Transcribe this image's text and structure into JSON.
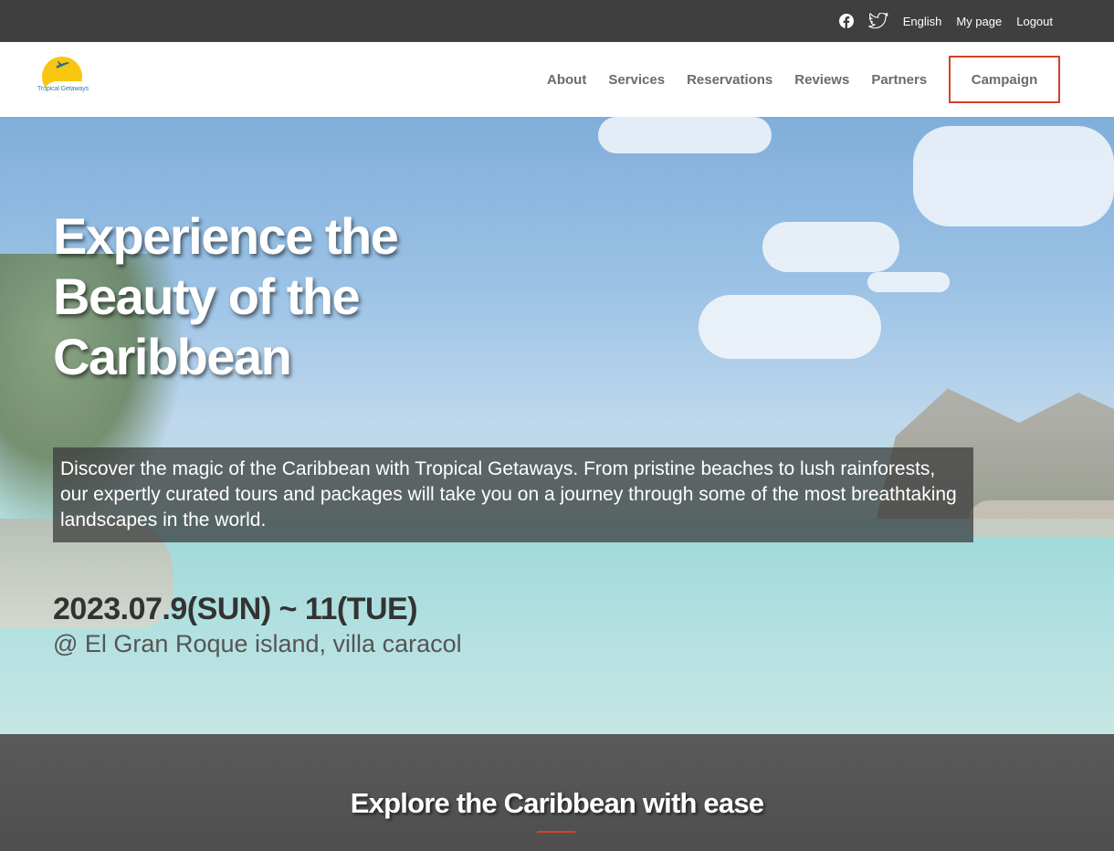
{
  "topbar": {
    "language": "English",
    "mypage": "My page",
    "logout": "Logout"
  },
  "logo": {
    "brand": "Tropical Getaways"
  },
  "nav": {
    "items": [
      {
        "label": "About"
      },
      {
        "label": "Services"
      },
      {
        "label": "Reservations"
      },
      {
        "label": "Reviews"
      },
      {
        "label": "Partners"
      }
    ],
    "campaign": "Campaign"
  },
  "hero": {
    "title": "Experience the Beauty of the Caribbean",
    "description": "Discover the magic of the Caribbean with Tropical Getaways. From pristine beaches to lush rainforests, our expertly curated tours and packages will take you on a journey through some of the most breathtaking landscapes in the world.",
    "date": "2023.07.9(SUN) ~ 11(TUE)",
    "venue": "@ El Gran Roque island, villa caracol"
  },
  "explore": {
    "heading": "Explore the Caribbean with ease"
  },
  "colors": {
    "topbar": "#3f3f3f",
    "accent": "#d6402a",
    "nav_text": "#6b6b6b",
    "logo_sun": "#f7c60f"
  },
  "icons": [
    "facebook-icon",
    "twitter-icon",
    "plane-icon"
  ]
}
